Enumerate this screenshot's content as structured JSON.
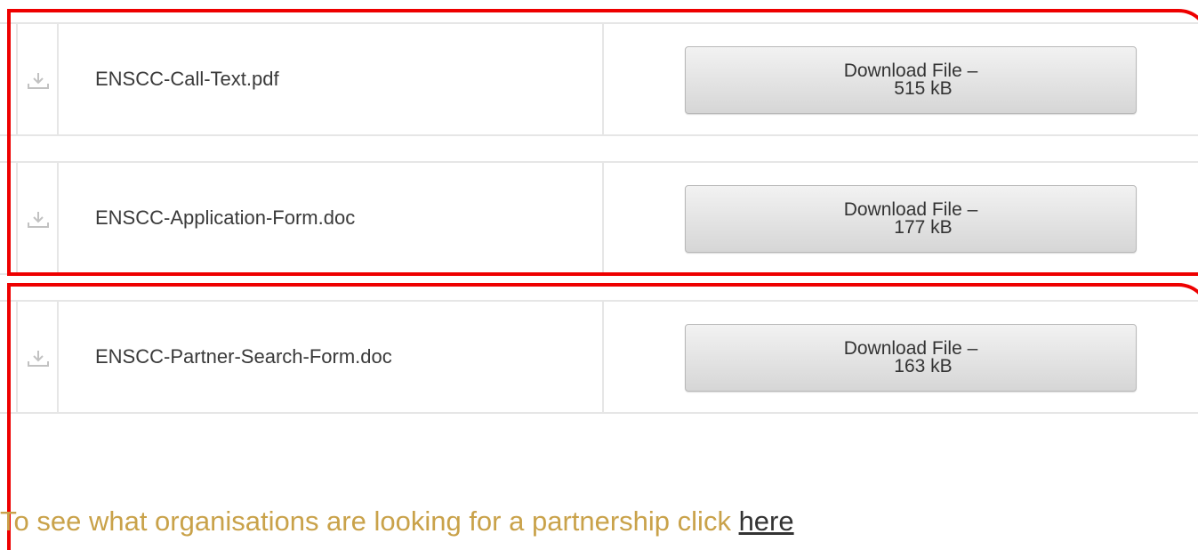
{
  "files": [
    {
      "name": "ENSCC-Call-Text.pdf",
      "button_line1": "Download File –",
      "button_line2": "515 kB",
      "icon": "download-icon"
    },
    {
      "name": "ENSCC-Application-Form.doc",
      "button_line1": "Download File –",
      "button_line2": "177 kB",
      "icon": "download-icon"
    },
    {
      "name": "ENSCC-Partner-Search-Form.doc",
      "button_line1": "Download File –",
      "button_line2": "163 kB",
      "icon": "download-icon"
    }
  ],
  "partnership": {
    "text": "To see what organisations are looking for a partnership click ",
    "link_label": "here"
  },
  "colors": {
    "highlight": "#ee0000",
    "partnership_text": "#c9a24a",
    "button_gradient_top": "#f2f2f2",
    "button_gradient_bottom": "#d6d6d6"
  }
}
